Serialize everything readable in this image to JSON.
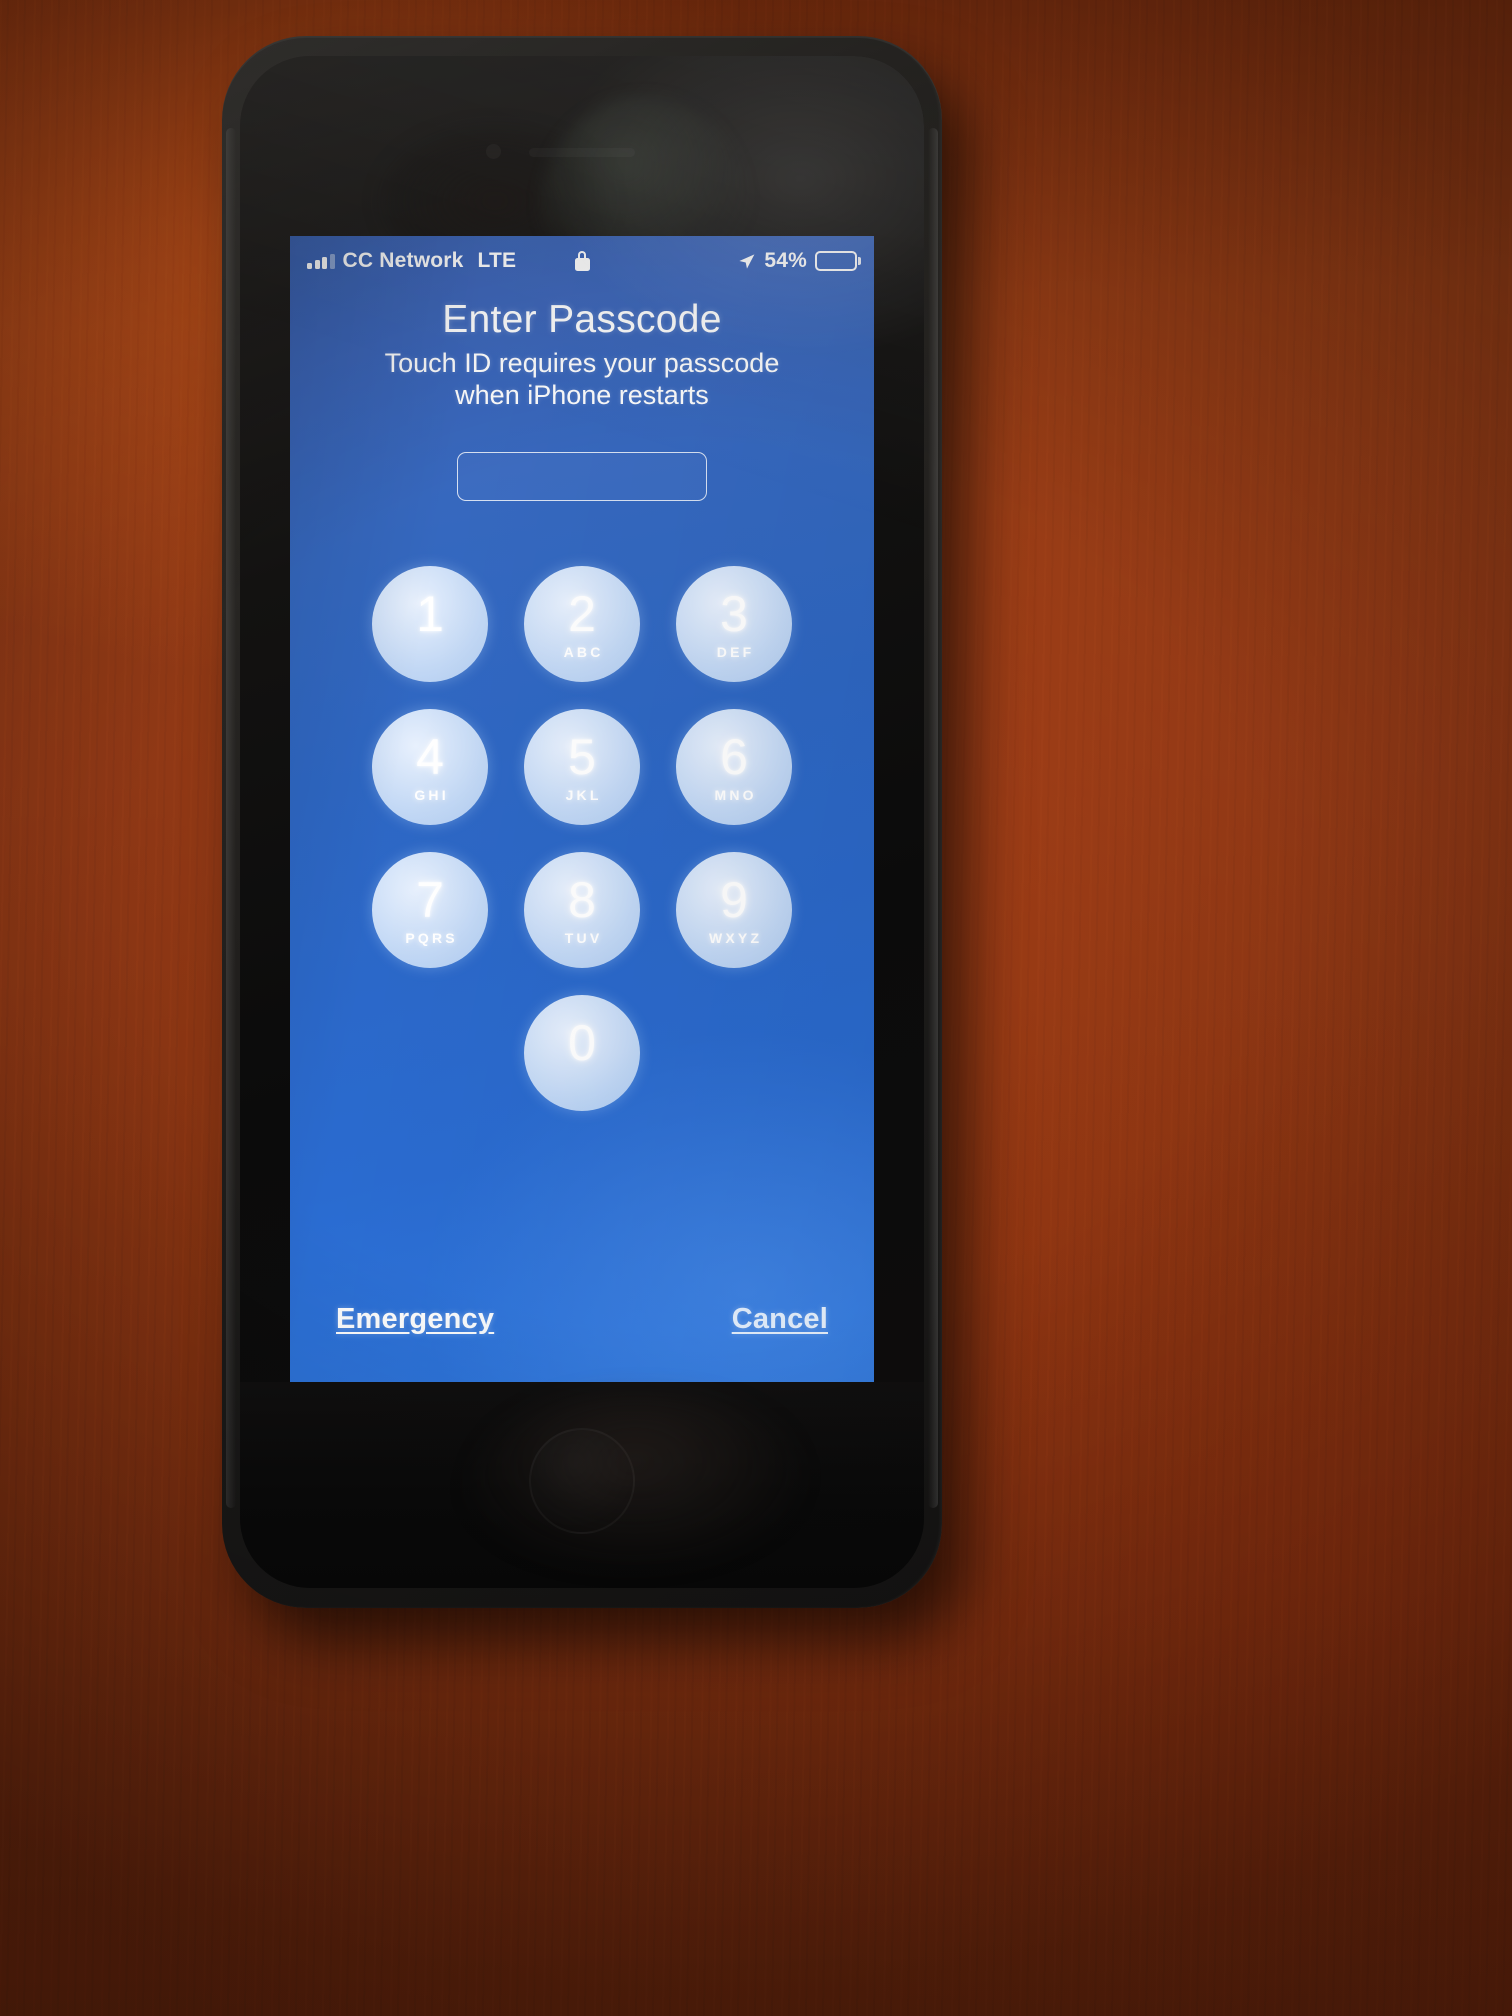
{
  "scene": {
    "description": "iPhone in black case on wood table showing iOS lock screen passcode prompt",
    "background_color": "#a8421a",
    "case_color": "#211f1d"
  },
  "status_bar": {
    "signal_icon": "signal-bars-icon",
    "signal_bars_filled": 3,
    "signal_bars_total": 4,
    "carrier": "CC Network",
    "network_type": "LTE",
    "lock_icon": "lock-icon",
    "location_icon": "location-arrow-icon",
    "battery_percent": "54%",
    "battery_level": 54,
    "battery_icon": "battery-icon"
  },
  "screen": {
    "title": "Enter Passcode",
    "subtitle_line1": "Touch ID requires your passcode",
    "subtitle_line2": "when iPhone restarts",
    "passcode_field": {
      "value": "",
      "placeholder": ""
    },
    "background_color": "#2d68c4"
  },
  "keypad": {
    "keys": [
      {
        "digit": "1",
        "letters": ""
      },
      {
        "digit": "2",
        "letters": "ABC"
      },
      {
        "digit": "3",
        "letters": "DEF"
      },
      {
        "digit": "4",
        "letters": "GHI"
      },
      {
        "digit": "5",
        "letters": "JKL"
      },
      {
        "digit": "6",
        "letters": "MNO"
      },
      {
        "digit": "7",
        "letters": "PQRS"
      },
      {
        "digit": "8",
        "letters": "TUV"
      },
      {
        "digit": "9",
        "letters": "WXYZ"
      },
      {
        "digit": "0",
        "letters": ""
      }
    ]
  },
  "actions": {
    "emergency_label": "Emergency",
    "cancel_label": "Cancel"
  },
  "hardware": {
    "earpiece": "earpiece-speaker",
    "front_camera": "front-camera-icon",
    "home_button": "home-button"
  }
}
